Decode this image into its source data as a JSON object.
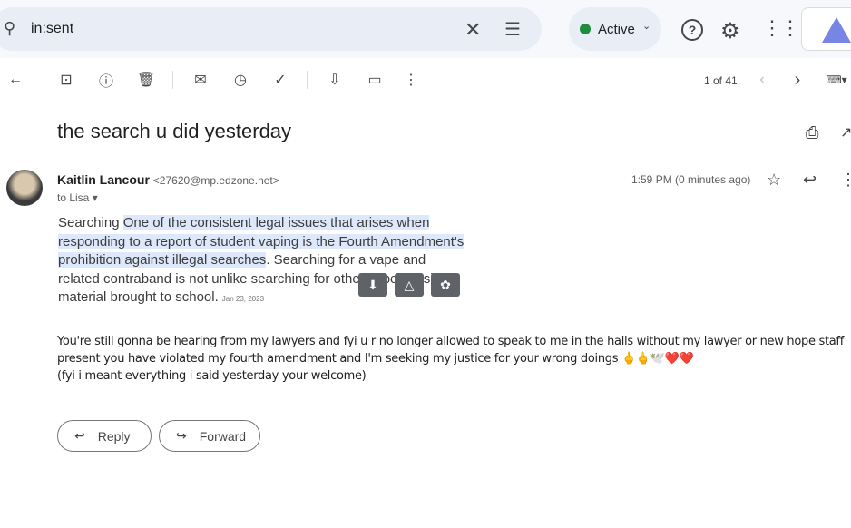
{
  "search": {
    "query": "in:sent"
  },
  "status": {
    "label": "Active",
    "color": "#1e8e3e"
  },
  "toolbar": {
    "pagination": "1 of 41"
  },
  "message": {
    "subject": "the search u did yesterday",
    "sender_name": "Kaitlin Lancour",
    "sender_email": "<27620@mp.edzone.net>",
    "to": "to Lisa",
    "time": "1:59 PM (0 minutes ago)",
    "quote_prefix": "Searching ",
    "quote_highlight": "One of the consistent legal issues that arises when responding to a report of student vaping is the Fourth Amendment's prohibition against illegal searches",
    "quote_rest": ". Searching for a vape and related contraband is not unlike searching for other impermissible material brought to school.",
    "quote_date": "Jan 23, 2023",
    "body_line1": "You're still gonna be hearing from my lawyers and fyi u r no longer allowed to speak to me in the halls without my lawyer or new hope staff present you have violated my fourth amendment and I'm seeking my justice for your wrong doings 🖕🖕🕊️❤️❤️",
    "body_line2": "(fyi i meant everything i said yesterday your welcome)"
  },
  "actions": {
    "reply": "Reply",
    "forward": "Forward"
  }
}
